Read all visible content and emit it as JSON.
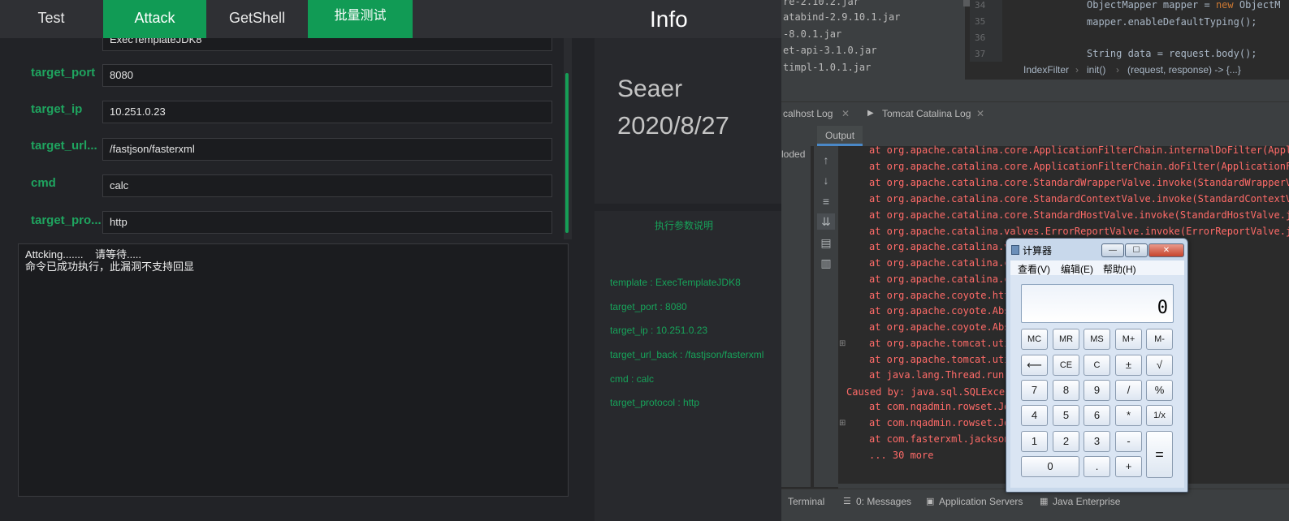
{
  "tool": {
    "tabs": [
      {
        "label": "Test"
      },
      {
        "label": "Attack"
      },
      {
        "label": "GetShell"
      },
      {
        "label": "批量测试"
      }
    ],
    "info_title": "Info",
    "form": {
      "template_value_partial": "ExecTemplateJDK8",
      "rows": [
        {
          "label": "target_port",
          "value": "8080"
        },
        {
          "label": "target_ip",
          "value": "10.251.0.23"
        },
        {
          "label": "target_url...",
          "value": "/fastjson/fasterxml"
        },
        {
          "label": "cmd",
          "value": "calc"
        },
        {
          "label": "target_pro...",
          "value": "http"
        }
      ]
    },
    "output_text": "Attcking.......    请等待.....\n命令已成功执行，此漏洞不支持回显",
    "info": {
      "author": "Seaer",
      "date": "2020/8/27"
    },
    "params": {
      "title": "执行参数说明",
      "lines": [
        "template : ExecTemplateJDK8",
        "target_port : 8080",
        "target_ip : 10.251.0.23",
        "target_url_back : /fastjson/fasterxml",
        "cmd : calc",
        "target_protocol : http"
      ]
    }
  },
  "ide": {
    "project_files": [
      "re-2.10.2.jar",
      "atabind-2.9.10.1.jar",
      "-8.0.1.jar",
      "et-api-3.1.0.jar",
      "timpl-1.0.1.jar"
    ],
    "line_numbers": [
      "34",
      "35",
      "36",
      "37"
    ],
    "code_lines": {
      "l34_type": "ObjectMapper mapper = ",
      "l34_new": "new",
      "l34_rest": " ObjectM",
      "l35": "mapper.enableDefaultTyping();",
      "l37": "String data = request.body();"
    },
    "breadcrumbs": [
      "IndexFilter",
      "init()",
      "(request, response) -> {...}"
    ],
    "log_tabs": [
      "calhost Log",
      "Tomcat Catalina Log"
    ],
    "output_tab": "Output",
    "strip_text": "loded",
    "toolbar_icons": [
      "arrow-up-icon",
      "arrow-down-icon",
      "soft-wrap-icon",
      "scroll-end-icon",
      "print-icon",
      "trash-icon"
    ],
    "log_lines": [
      "at org.apache.catalina.core.ApplicationFilterChain.internalDoFilter(Appl",
      "at org.apache.catalina.core.ApplicationFilterChain.doFilter(ApplicationF",
      "at org.apache.catalina.core.StandardWrapperValve.invoke(StandardWrapperV",
      "at org.apache.catalina.core.StandardContextValve.invoke(StandardContextV",
      "at org.apache.catalina.core.StandardHostValve.invoke(StandardHostValve.j",
      "at org.apache.catalina.valves.ErrorReportValve.invoke(ErrorReportValve.j",
      "at org.apache.catalina.v                   ke(AbstractAcce",
      "at org.apache.catalina.co                  andardEngineVal",
      "at org.apache.catalina.co                  oyoteAdapter.jav",
      "at org.apache.coyote.http                  1Processor.java",
      "at org.apache.coyote.Abst                  actProcessorLig",
      "at org.apache.coyote.Abst                  rocess(Abstract",
      "at org.apache.tomcat.uti                   .run(NioEndpoin",
      "at org.apache.tomcat.uti                   able.run(TaskTh",
      "at java.lang.Thread.run(",
      "Caused by: java.sql.SQLExcept                     连接",
      "at com.nqadmin.rowset.Jdl                  mpl.java:638)",
      "at com.nqadmin.rowset.Jdl                  wSetImpl.java:4",
      "at com.fasterxml.jackson                   ty.deserializeA",
      "... 30 more"
    ],
    "bottom_tabs": [
      "Terminal",
      "0: Messages",
      "Application Servers",
      "Java Enterprise"
    ]
  },
  "calculator": {
    "title": "计算器",
    "window_buttons": [
      "—",
      "☐",
      "✕"
    ],
    "menu": [
      "查看(V)",
      "编辑(E)",
      "帮助(H)"
    ],
    "display": "0",
    "keys": [
      "MC",
      "MR",
      "MS",
      "M+",
      "M-",
      "⟵",
      "CE",
      "C",
      "±",
      "√",
      "7",
      "8",
      "9",
      "/",
      "%",
      "4",
      "5",
      "6",
      "*",
      "1/x",
      "1",
      "2",
      "3",
      "-",
      "=",
      "0",
      ".",
      "+"
    ]
  }
}
